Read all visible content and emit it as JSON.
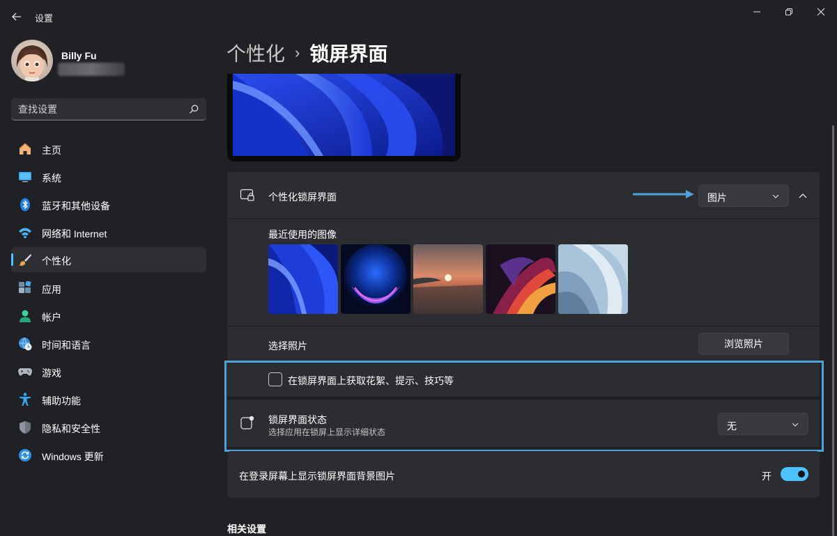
{
  "window": {
    "title": "设置"
  },
  "user": {
    "name": "Billy Fu"
  },
  "search": {
    "placeholder": "查找设置"
  },
  "sidebar": {
    "items": [
      {
        "label": "主页",
        "icon": "home-icon"
      },
      {
        "label": "系统",
        "icon": "system-icon"
      },
      {
        "label": "蓝牙和其他设备",
        "icon": "bluetooth-icon"
      },
      {
        "label": "网络和 Internet",
        "icon": "wifi-icon"
      },
      {
        "label": "个性化",
        "icon": "brush-icon",
        "active": true
      },
      {
        "label": "应用",
        "icon": "apps-icon"
      },
      {
        "label": "帐户",
        "icon": "account-icon"
      },
      {
        "label": "时间和语言",
        "icon": "time-language-icon"
      },
      {
        "label": "游戏",
        "icon": "gamepad-icon"
      },
      {
        "label": "辅助功能",
        "icon": "accessibility-icon"
      },
      {
        "label": "隐私和安全性",
        "icon": "shield-icon"
      },
      {
        "label": "Windows 更新",
        "icon": "update-icon"
      }
    ]
  },
  "breadcrumb": {
    "parent": "个性化",
    "separator": "›",
    "current": "锁屏界面"
  },
  "lockscreen": {
    "personalize_title": "个性化锁屏界面",
    "personalize_value": "图片",
    "recent_images_label": "最近使用的图像",
    "choose_photo_label": "选择照片",
    "browse_button": "浏览照片",
    "tips_checkbox_label": "在锁屏界面上获取花絮、提示、技巧等",
    "tips_checked": false,
    "status_title": "锁屏界面状态",
    "status_subtitle": "选择应用在锁屏上显示详细状态",
    "status_value": "无",
    "signin_bg_label": "在登录屏幕上显示锁屏界面背景图片",
    "signin_bg_state": "开",
    "signin_bg_on": true
  },
  "related": {
    "title": "相关设置"
  },
  "colors": {
    "accent": "#4cc2ff",
    "annotation": "#4da3d9",
    "background": "#202124",
    "card": "#2b2d30"
  }
}
